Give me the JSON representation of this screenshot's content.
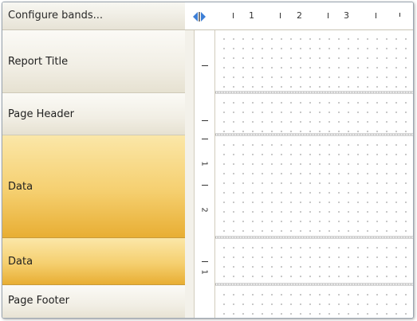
{
  "toolbar": {
    "configure_label": "Configure bands..."
  },
  "bands": [
    {
      "label": "Report Title",
      "selected": false
    },
    {
      "label": "Page Header",
      "selected": false
    },
    {
      "label": "Data",
      "selected": true
    },
    {
      "label": "Data",
      "selected": true
    },
    {
      "label": "Page Footer",
      "selected": false
    }
  ],
  "ruler": {
    "horizontal_labels": [
      "1",
      "2",
      "3"
    ],
    "vertical_labels": [
      "1",
      "2",
      "1"
    ]
  },
  "colors": {
    "selected_band_top": "#fbe7a8",
    "selected_band_bottom": "#e8ae33",
    "splitter_arrow": "#3d7fd6"
  }
}
